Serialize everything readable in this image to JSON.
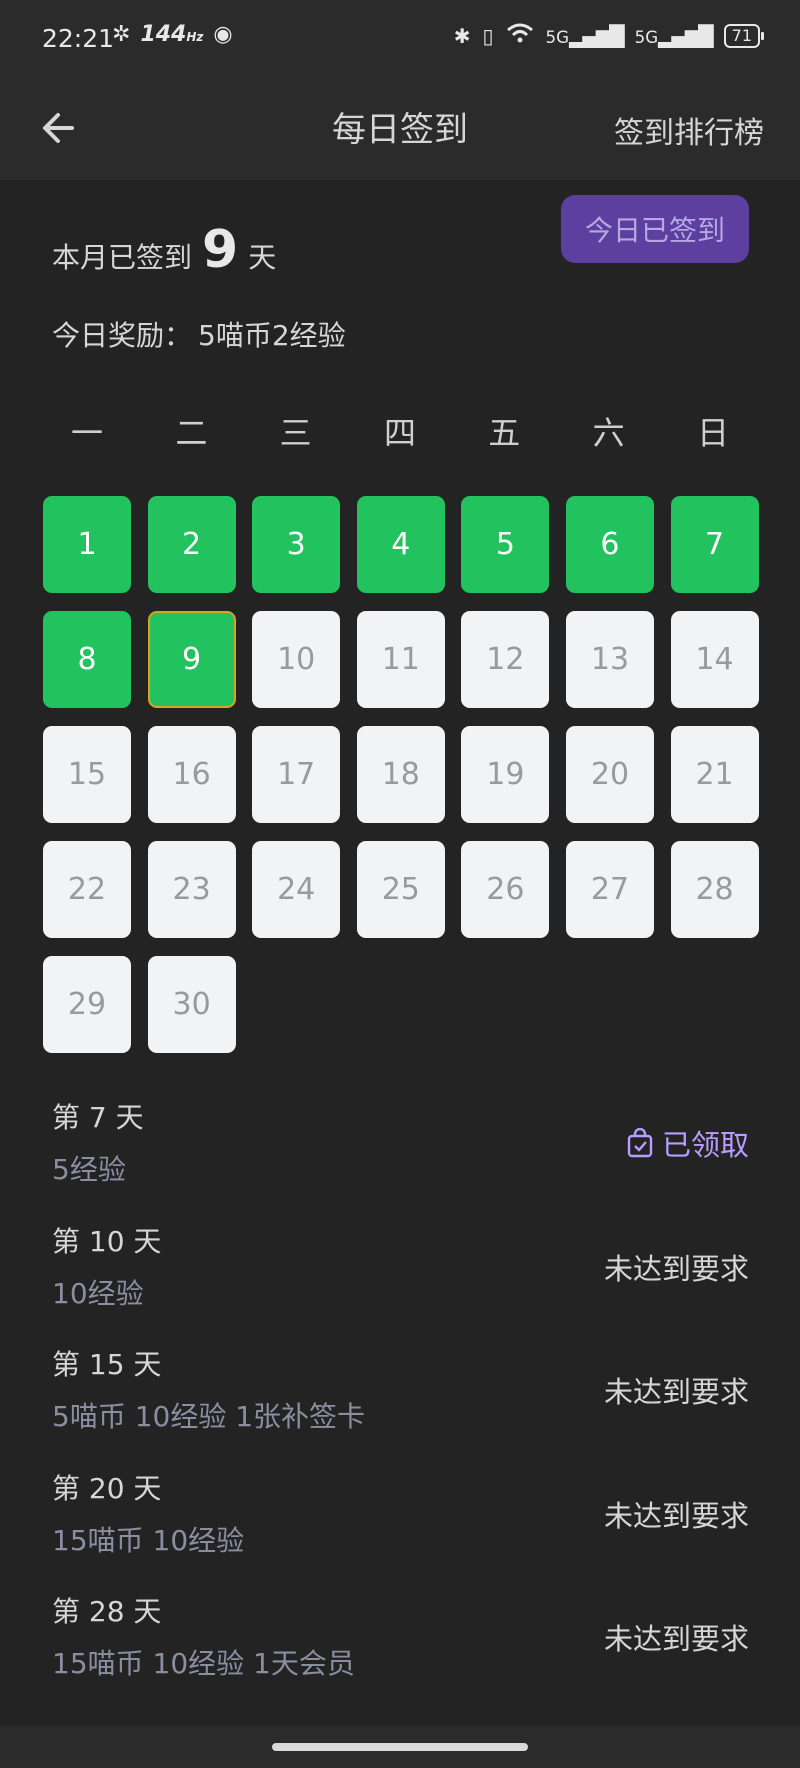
{
  "status": {
    "time": "22:21",
    "refresh_rate": "144",
    "refresh_unit": "Hz",
    "network_1": "5G",
    "network_2": "5G",
    "battery": "71"
  },
  "header": {
    "title": "每日签到",
    "rank_label": "签到排行榜"
  },
  "summary": {
    "prefix": "本月已签到",
    "days": "9",
    "suffix": "天",
    "reward_label": "今日奖励：",
    "reward_value": "5喵币2经验",
    "button_label": "今日已签到"
  },
  "weekdays": [
    "一",
    "二",
    "三",
    "四",
    "五",
    "六",
    "日"
  ],
  "days": [
    "1",
    "2",
    "3",
    "4",
    "5",
    "6",
    "7",
    "8",
    "9",
    "10",
    "11",
    "12",
    "13",
    "14",
    "15",
    "16",
    "17",
    "18",
    "19",
    "20",
    "21",
    "22",
    "23",
    "24",
    "25",
    "26",
    "27",
    "28",
    "29",
    "30"
  ],
  "rewards": [
    {
      "title": "第 7 天",
      "desc": "5经验",
      "status": "已领取"
    },
    {
      "title": "第 10 天",
      "desc": "10经验",
      "status": "未达到要求"
    },
    {
      "title": "第 15 天",
      "desc": "5喵币 10经验 1张补签卡",
      "status": "未达到要求"
    },
    {
      "title": "第 20 天",
      "desc": "15喵币 10经验",
      "status": "未达到要求"
    },
    {
      "title": "第 28 天",
      "desc": "15喵币 10经验 1天会员",
      "status": "未达到要求"
    }
  ],
  "colors": {
    "signed": "#22c35e",
    "today_border": "#d6a41e",
    "accent": "#5c3f9e",
    "claimed": "#b99cff"
  }
}
